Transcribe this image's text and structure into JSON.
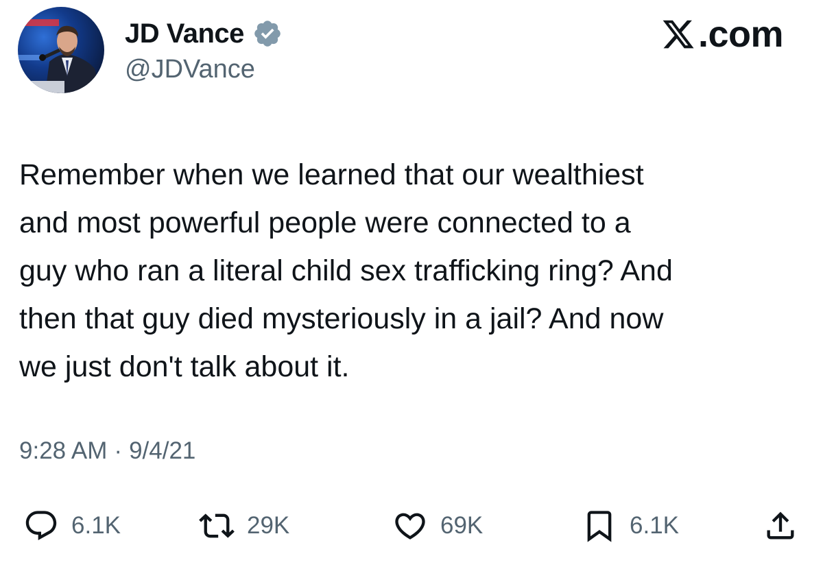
{
  "profile": {
    "display_name": "JD Vance",
    "handle": "@JDVance",
    "verified": true,
    "badge_color": "#829aab"
  },
  "site": {
    "logo_text": ".com",
    "logo_icon": "x-logo-icon"
  },
  "tweet": {
    "text": "Remember when we learned that our wealthiest\nand most powerful people were connected to a\nguy who ran a literal child sex trafficking ring? And\nthen that guy died mysteriously in a jail? And now\nwe just don't talk about it.",
    "time": "9:28 AM",
    "separator": "·",
    "date": "9/4/21"
  },
  "actions": {
    "reply": {
      "icon": "reply-icon",
      "count": "6.1K"
    },
    "retweet": {
      "icon": "retweet-icon",
      "count": "29K"
    },
    "like": {
      "icon": "heart-icon",
      "count": "69K"
    },
    "bookmark": {
      "icon": "bookmark-icon",
      "count": "6.1K"
    },
    "share": {
      "icon": "share-icon"
    }
  },
  "colors": {
    "text_primary": "#0f1419",
    "text_secondary": "#536471",
    "background": "#ffffff"
  }
}
